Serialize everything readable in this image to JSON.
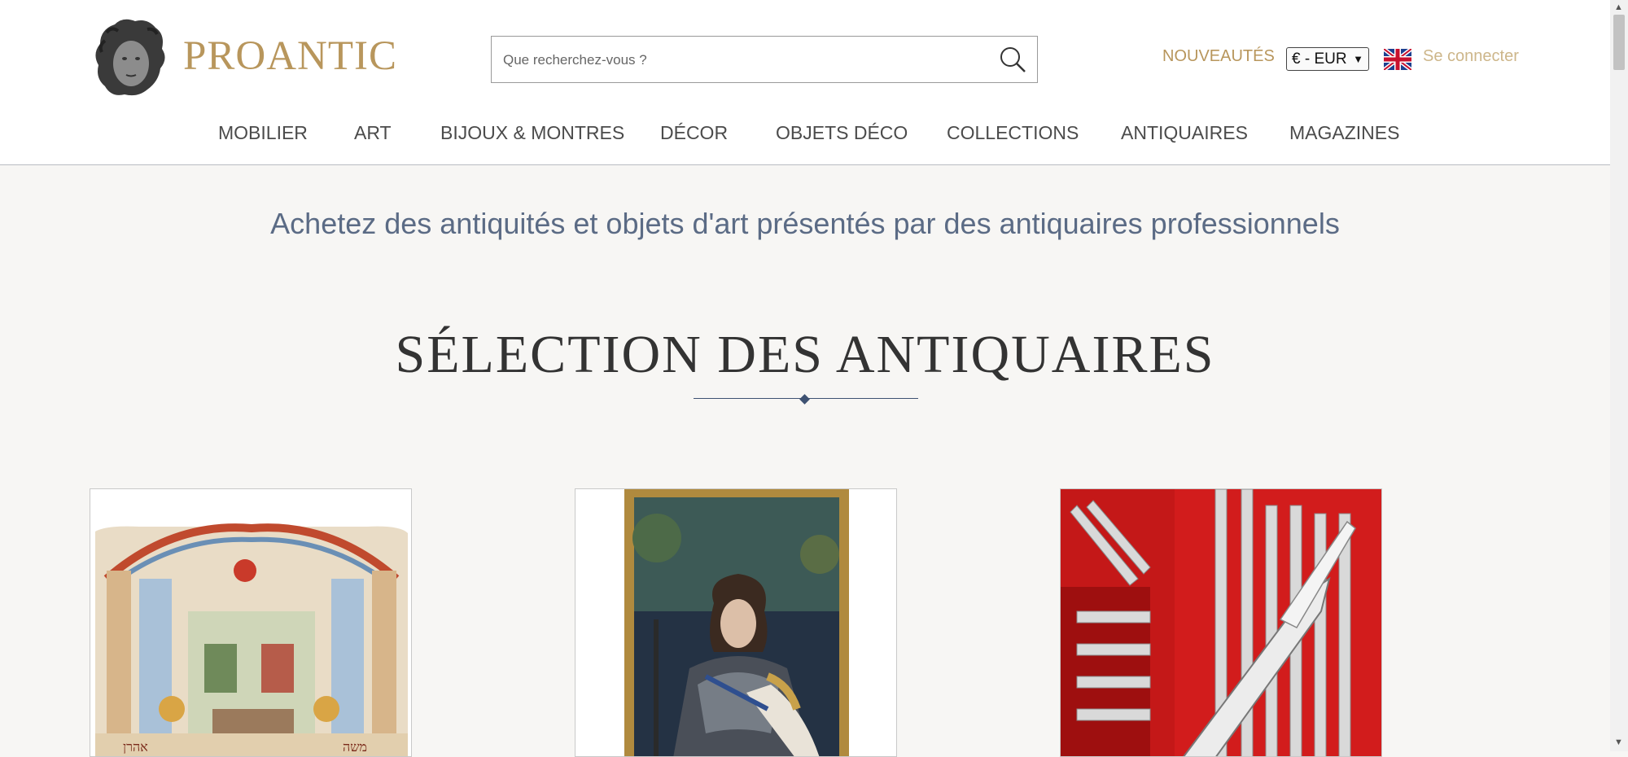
{
  "header": {
    "logo_text": "PROANTIC",
    "search": {
      "placeholder": "Que recherchez-vous ?"
    },
    "new_label": "NOUVEAUTÉS",
    "currency_label": "€ - EUR",
    "login_label": "Se connecter"
  },
  "nav": {
    "items": [
      {
        "label": "MOBILIER"
      },
      {
        "label": "ART"
      },
      {
        "label": "BIJOUX & MONTRES"
      },
      {
        "label": "DÉCOR"
      },
      {
        "label": "OBJETS DÉCO"
      },
      {
        "label": "COLLECTIONS"
      },
      {
        "label": "ANTIQUAIRES"
      },
      {
        "label": "MAGAZINES"
      }
    ]
  },
  "main": {
    "tagline": "Achetez des antiquités et objets d'art présentés par des antiquaires professionnels",
    "section_title": "SÉLECTION DES ANTIQUAIRES"
  },
  "colors": {
    "brand_gold": "#b8965c",
    "tagline_blue": "#5b6b85",
    "rule_blue": "#3e5272",
    "page_bg": "#f7f6f4"
  }
}
